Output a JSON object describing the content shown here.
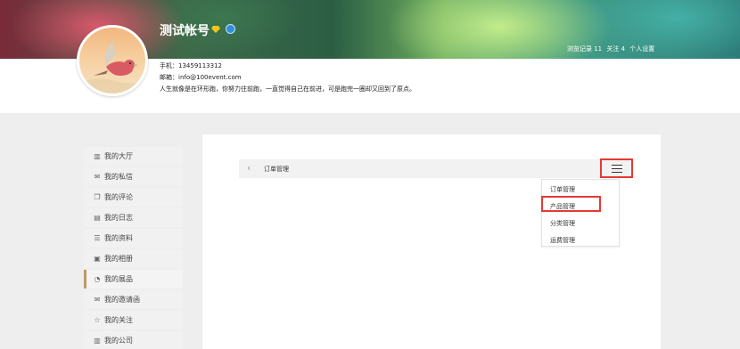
{
  "profile": {
    "username": "测试帐号",
    "phone": "手机：13459113312",
    "email": "邮箱：info@100event.com",
    "bio": "人生就像是在环形跑，你努力往前跑，一直觉得自己在前进，可是跑完一圈却又回到了原点。",
    "diamond_icon": "diamond-icon",
    "badge_icon": "badge-icon",
    "stats": {
      "visits": "浏览记录 11",
      "follows": "关注 4",
      "settings": "个人设置"
    }
  },
  "sidebar": {
    "items": [
      {
        "label": "我的大厅",
        "icon": "hall-icon",
        "glyph": "▥"
      },
      {
        "label": "我的私信",
        "icon": "message-icon",
        "glyph": "✉"
      },
      {
        "label": "我的评论",
        "icon": "comment-icon",
        "glyph": "❐"
      },
      {
        "label": "我的日志",
        "icon": "log-icon",
        "glyph": "▤"
      },
      {
        "label": "我的资料",
        "icon": "profile-icon",
        "glyph": "☰"
      },
      {
        "label": "我的相册",
        "icon": "album-icon",
        "glyph": "▣"
      },
      {
        "label": "我的展品",
        "icon": "exhibit-icon",
        "glyph": "◔",
        "active": true
      },
      {
        "label": "我的邀请函",
        "icon": "invitation-icon",
        "glyph": "✉"
      },
      {
        "label": "我的关注",
        "icon": "star-icon",
        "glyph": "☆"
      },
      {
        "label": "我的公司",
        "icon": "company-icon",
        "glyph": "▥"
      }
    ]
  },
  "main": {
    "nav_title": "订单管理",
    "back_icon": "chevron-left-icon",
    "menu_icon": "hamburger-menu-icon",
    "dropdown": [
      "订单管理",
      "产品管理",
      "分类管理",
      "运费管理"
    ],
    "highlight_color": "#e53935"
  }
}
